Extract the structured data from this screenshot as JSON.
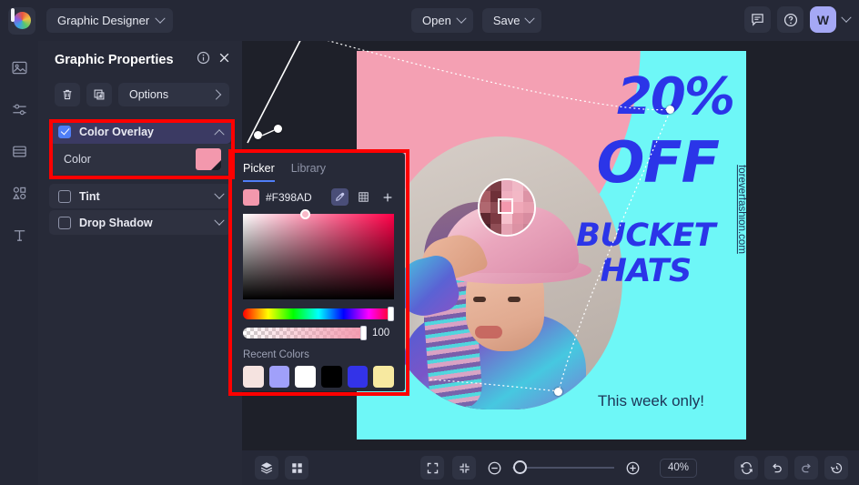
{
  "topbar": {
    "logo_icon": "app-logo-swirl",
    "document_name": "Graphic Designer",
    "open_label": "Open",
    "save_label": "Save",
    "comment_icon": "comment-icon",
    "help_icon": "help-circle-icon",
    "avatar_initial": "W"
  },
  "rail": {
    "items": [
      {
        "icon": "image-icon"
      },
      {
        "icon": "adjustments-icon"
      },
      {
        "icon": "layers-list-icon"
      },
      {
        "icon": "shapes-icon"
      },
      {
        "icon": "text-icon"
      }
    ]
  },
  "panel": {
    "title": "Graphic Properties",
    "info_icon": "info-circle-icon",
    "close_icon": "close-icon",
    "delete_icon": "trash-icon",
    "duplicate_icon": "duplicate-icon",
    "options_label": "Options",
    "sections": [
      {
        "label": "Color Overlay",
        "checked": true,
        "expanded": true
      },
      {
        "label": "Tint",
        "checked": false,
        "expanded": false
      },
      {
        "label": "Drop Shadow",
        "checked": false,
        "expanded": false
      }
    ],
    "color_row": {
      "label": "Color",
      "value": "#F398AD"
    }
  },
  "picker": {
    "tabs": [
      {
        "label": "Picker",
        "active": true
      },
      {
        "label": "Library",
        "active": false
      }
    ],
    "hex": "#F398AD",
    "eyedropper_icon": "eyedropper-icon",
    "palette_icon": "grid-palette-icon",
    "add_icon": "plus-icon",
    "alpha_value": "100",
    "recent_label": "Recent Colors",
    "recent_colors": [
      "#f5e3e0",
      "#a0a0fa",
      "#ffffff",
      "#000000",
      "#3333e8",
      "#f7e9a0"
    ]
  },
  "canvas": {
    "headline_top": "20%",
    "headline_off": "OFF",
    "headline_product": "BUCKET\nHATS",
    "subline": "This week only!",
    "website": "foreverfashion.com",
    "bg_color": "#6EF7F7",
    "accent_color": "#2B35E8",
    "shape_color": "#F4A0B3",
    "loupe_icon": "eyedropper-loupe"
  },
  "bottombar": {
    "layers_icon": "layers-icon",
    "grid_icon": "grid-icon",
    "fit_screen_icon": "fit-screen-icon",
    "fit_content_icon": "fit-content-icon",
    "zoom_out_icon": "zoom-out-icon",
    "zoom_in_icon": "zoom-in-icon",
    "zoom_level": "40%",
    "reset_icon": "reset-icon",
    "undo_icon": "undo-icon",
    "redo_icon": "redo-icon",
    "history_icon": "history-icon"
  }
}
